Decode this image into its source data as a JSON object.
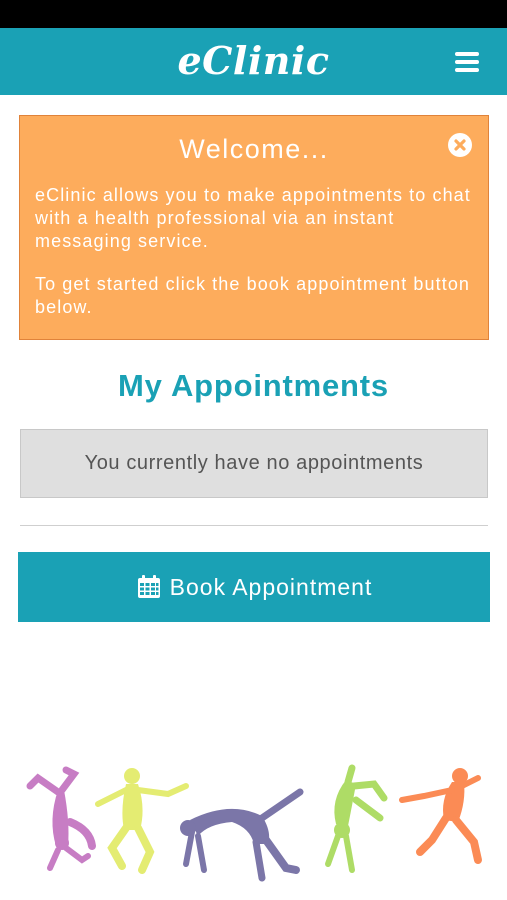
{
  "app": {
    "logo_text": "eClinic"
  },
  "header": {
    "menu_icon": "hamburger-menu-icon",
    "color": "#1aa1b5"
  },
  "welcome": {
    "title": "Welcome...",
    "paragraph_1": "eClinic allows you to make appointments to chat with a health professional via an instant messaging service.",
    "paragraph_2": "To get started click the book appointment button below.",
    "close_icon": "close-circle-icon",
    "background": "#fdac5c"
  },
  "appointments": {
    "heading": "My Appointments",
    "empty_message": "You currently have no appointments"
  },
  "book_button": {
    "label": "Book Appointment",
    "icon": "calendar-icon"
  },
  "decoration": {
    "dancer_colors": [
      "#c77dc4",
      "#e4ec72",
      "#7b76a8",
      "#aedc66",
      "#fb8b55"
    ]
  }
}
